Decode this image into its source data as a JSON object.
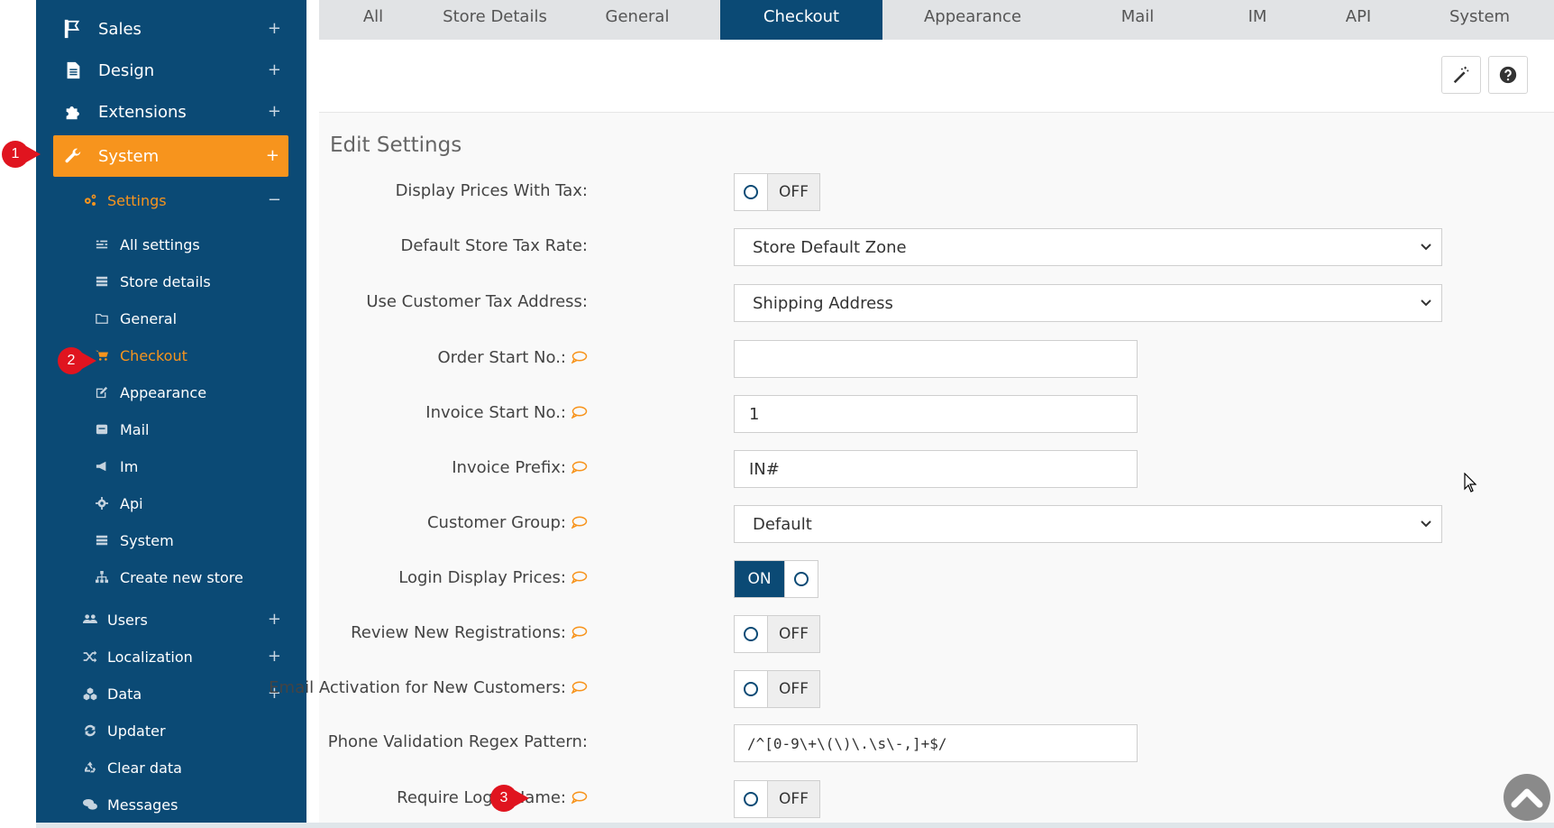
{
  "sidebar": {
    "top_items": [
      {
        "label": "Sales",
        "icon": "flag-icon",
        "expand": "+"
      },
      {
        "label": "Design",
        "icon": "document-icon",
        "expand": "+"
      },
      {
        "label": "Extensions",
        "icon": "puzzle-icon",
        "expand": "+"
      },
      {
        "label": "System",
        "icon": "wrench-icon",
        "expand": "+",
        "active": true
      }
    ],
    "settings": {
      "label": "Settings",
      "icon": "gears-icon",
      "expand": "−"
    },
    "settings_items": [
      {
        "label": "All settings",
        "icon": "sliders-icon"
      },
      {
        "label": "Store details",
        "icon": "list-icon"
      },
      {
        "label": "General",
        "icon": "folder-icon"
      },
      {
        "label": "Checkout",
        "icon": "cart-icon",
        "active": true
      },
      {
        "label": "Appearance",
        "icon": "edit-icon"
      },
      {
        "label": "Mail",
        "icon": "envelope-icon"
      },
      {
        "label": "Im",
        "icon": "megaphone-icon"
      },
      {
        "label": "Api",
        "icon": "cog-icon"
      },
      {
        "label": "System",
        "icon": "server-icon"
      },
      {
        "label": "Create new store",
        "icon": "sitemap-icon"
      }
    ],
    "lower_items": [
      {
        "label": "Users",
        "icon": "users-icon",
        "expand": "+"
      },
      {
        "label": "Localization",
        "icon": "shuffle-icon",
        "expand": "+"
      },
      {
        "label": "Data",
        "icon": "cubes-icon",
        "expand": "+"
      },
      {
        "label": "Updater",
        "icon": "refresh-icon"
      },
      {
        "label": "Clear data",
        "icon": "recycle-icon"
      },
      {
        "label": "Messages",
        "icon": "comments-icon"
      }
    ]
  },
  "markers": [
    "1",
    "2",
    "3"
  ],
  "tabs": [
    {
      "label": "All"
    },
    {
      "label": "Store Details"
    },
    {
      "label": "General"
    },
    {
      "label": "Checkout",
      "active": true
    },
    {
      "label": "Appearance"
    },
    {
      "label": "Mail"
    },
    {
      "label": "IM"
    },
    {
      "label": "API"
    },
    {
      "label": "System"
    }
  ],
  "toolbar": {
    "wand_icon": "magic-wand-icon",
    "help_icon": "question-circle-icon"
  },
  "panel_title": "Edit Settings",
  "form": {
    "display_prices_with_tax": {
      "label": "Display Prices With Tax:",
      "state": "OFF"
    },
    "default_store_tax_rate": {
      "label": "Default Store Tax Rate:",
      "value": "Store Default Zone"
    },
    "use_customer_tax_address": {
      "label": "Use Customer Tax Address:",
      "value": "Shipping Address"
    },
    "order_start_no": {
      "label": "Order Start No.:",
      "value": ""
    },
    "invoice_start_no": {
      "label": "Invoice Start No.:",
      "value": "1"
    },
    "invoice_prefix": {
      "label": "Invoice Prefix:",
      "value": "IN#"
    },
    "customer_group": {
      "label": "Customer Group:",
      "value": "Default"
    },
    "login_display_prices": {
      "label": "Login Display Prices:",
      "state": "ON"
    },
    "review_new_registrations": {
      "label": "Review New Registrations:",
      "state": "OFF"
    },
    "email_activation": {
      "label": "Email Activation for New Customers:",
      "state": "OFF"
    },
    "phone_regex": {
      "label": "Phone Validation Regex Pattern:",
      "value": "/^[0-9\\+\\(\\)\\.\\s\\-,]+$/"
    },
    "require_login_name": {
      "label": "Require Login Name:",
      "state": "OFF"
    }
  },
  "colors": {
    "sidebar": "#0b4a75",
    "accent": "#f7941d",
    "marker": "#e0141f"
  }
}
